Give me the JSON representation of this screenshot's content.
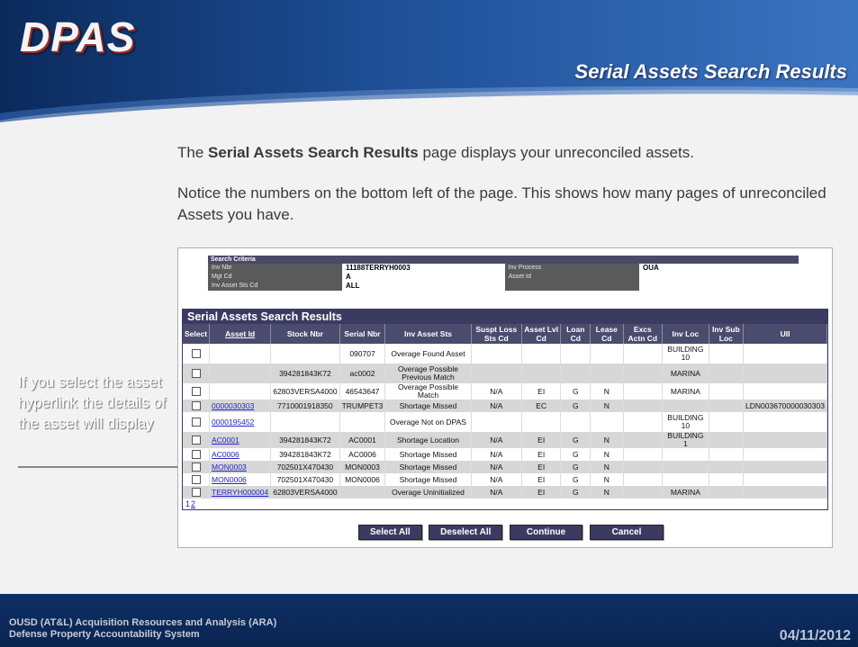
{
  "header": {
    "logo": "DPAS",
    "slide_title": "Serial Assets Search Results"
  },
  "intro": {
    "p1_before": "The ",
    "p1_bold": "Serial Assets Search Results",
    "p1_after": " page displays your unreconciled assets.",
    "p2": "Notice the numbers on the bottom left of the page. This shows how many pages of unreconciled Assets you have."
  },
  "callout": {
    "text": "If you select the asset hyperlink the details of the asset will display"
  },
  "criteria": {
    "header": "Search Criteria",
    "rows": [
      {
        "k1": "Inv Nbr",
        "v1": "11188TERRYH0003",
        "k2": "Inv Process",
        "v2": "OUA"
      },
      {
        "k1": "Mgt Cd",
        "v1": "A",
        "k2": "Asset Id",
        "v2": ""
      },
      {
        "k1": "Inv Asset Sts Cd",
        "v1": "ALL",
        "k2": "",
        "v2": ""
      }
    ]
  },
  "results": {
    "title": "Serial Assets Search Results",
    "columns": [
      "Select",
      "Asset Id",
      "Stock Nbr",
      "Serial Nbr",
      "Inv Asset Sts",
      "Suspt Loss Sts Cd",
      "Asset Lvl Cd",
      "Loan Cd",
      "Lease Cd",
      "Excs Actn Cd",
      "Inv Loc",
      "Inv Sub Loc",
      "UII"
    ],
    "rows": [
      {
        "asset": "",
        "stock": "",
        "serial": "090707",
        "sts": "Overage Found Asset",
        "loss": "",
        "lvl": "",
        "loan": "",
        "lease": "",
        "excs": "",
        "loc": "BUILDING 10",
        "sub": "",
        "uii": ""
      },
      {
        "asset": "",
        "stock": "394281843K72",
        "serial": "ac0002",
        "sts": "Overage Possible Previous Match",
        "loss": "",
        "lvl": "",
        "loan": "",
        "lease": "",
        "excs": "",
        "loc": "MARINA",
        "sub": "",
        "uii": ""
      },
      {
        "asset": "",
        "stock": "62803VERSA4000",
        "serial": "46543647",
        "sts": "Overage Possible Match",
        "loss": "N/A",
        "lvl": "EI",
        "loan": "G",
        "lease": "N",
        "excs": "",
        "loc": "MARINA",
        "sub": "",
        "uii": ""
      },
      {
        "asset": "0000030303",
        "stock": "7710001918350",
        "serial": "TRUMPET3",
        "sts": "Shortage Missed",
        "loss": "N/A",
        "lvl": "EC",
        "loan": "G",
        "lease": "N",
        "excs": "",
        "loc": "",
        "sub": "",
        "uii": "LDN003670000030303"
      },
      {
        "asset": "0000195452",
        "stock": "",
        "serial": "",
        "sts": "Overage Not on DPAS",
        "loss": "",
        "lvl": "",
        "loan": "",
        "lease": "",
        "excs": "",
        "loc": "BUILDING 10",
        "sub": "",
        "uii": ""
      },
      {
        "asset": "AC0001",
        "stock": "394281843K72",
        "serial": "AC0001",
        "sts": "Shortage Location",
        "loss": "N/A",
        "lvl": "EI",
        "loan": "G",
        "lease": "N",
        "excs": "",
        "loc": "BUILDING 1",
        "sub": "",
        "uii": ""
      },
      {
        "asset": "AC0006",
        "stock": "394281843K72",
        "serial": "AC0006",
        "sts": "Shortage Missed",
        "loss": "N/A",
        "lvl": "EI",
        "loan": "G",
        "lease": "N",
        "excs": "",
        "loc": "",
        "sub": "",
        "uii": ""
      },
      {
        "asset": "MON0003",
        "stock": "702501X470430",
        "serial": "MON0003",
        "sts": "Shortage Missed",
        "loss": "N/A",
        "lvl": "EI",
        "loan": "G",
        "lease": "N",
        "excs": "",
        "loc": "",
        "sub": "",
        "uii": ""
      },
      {
        "asset": "MON0006",
        "stock": "702501X470430",
        "serial": "MON0006",
        "sts": "Shortage Missed",
        "loss": "N/A",
        "lvl": "EI",
        "loan": "G",
        "lease": "N",
        "excs": "",
        "loc": "",
        "sub": "",
        "uii": ""
      },
      {
        "asset": "TERRYH000004",
        "stock": "62803VERSA4000",
        "serial": "",
        "sts": "Overage Uninitialized",
        "loss": "N/A",
        "lvl": "EI",
        "loan": "G",
        "lease": "N",
        "excs": "",
        "loc": "MARINA",
        "sub": "",
        "uii": ""
      }
    ],
    "pages": [
      "1",
      "2"
    ]
  },
  "buttons": {
    "select_all": "Select All",
    "deselect_all": "Deselect All",
    "continue": "Continue",
    "cancel": "Cancel"
  },
  "footer": {
    "line1": "OUSD (AT&L) Acquisition Resources and Analysis (ARA)",
    "line2": "Defense Property Accountability System",
    "date": "04/11/2012"
  }
}
